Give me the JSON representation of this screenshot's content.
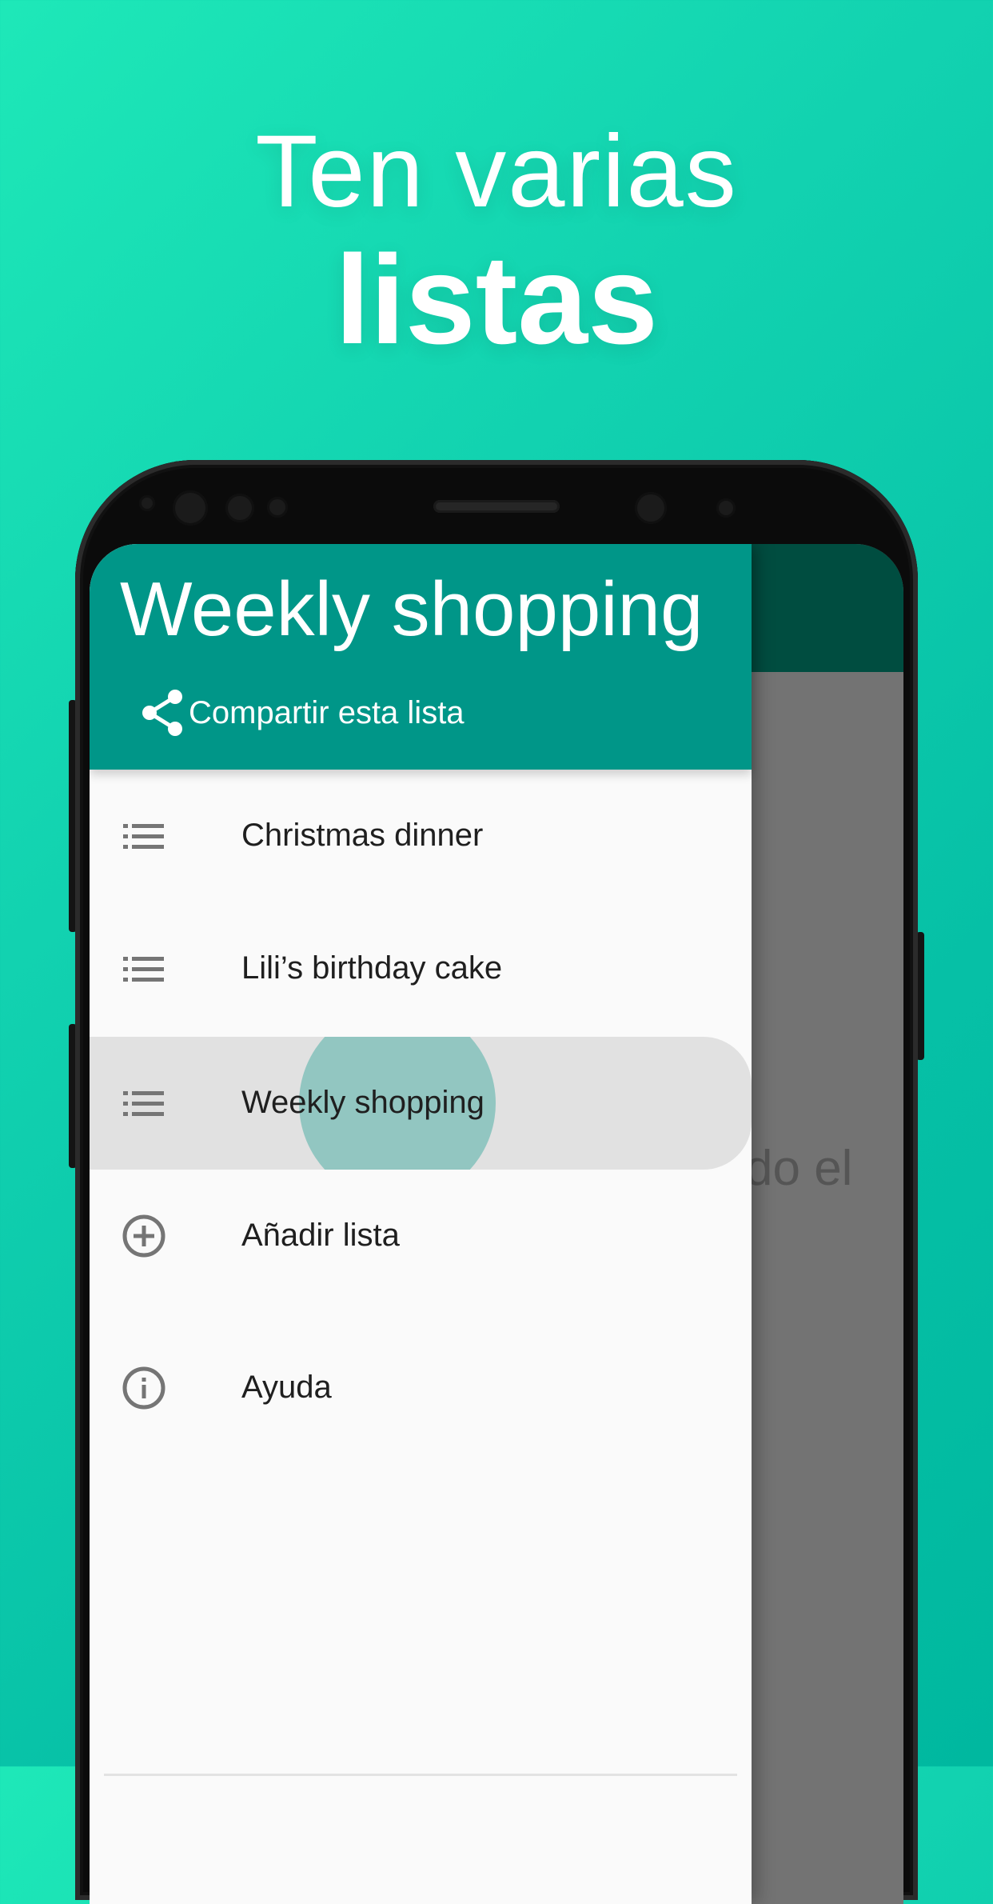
{
  "promo": {
    "line1": "Ten varias",
    "line2": "listas"
  },
  "background_screen": {
    "partial_text": "do el"
  },
  "drawer": {
    "title": "Weekly shopping",
    "share_label": "Compartir esta lista",
    "lists": [
      {
        "label": "Christmas dinner",
        "icon": "list-icon",
        "selected": false
      },
      {
        "label": "Lili’s birthday cake",
        "icon": "list-icon",
        "selected": false
      },
      {
        "label": "Weekly shopping",
        "icon": "list-icon",
        "selected": true
      }
    ],
    "add_list_label": "Añadir lista",
    "help_label": "Ayuda"
  },
  "colors": {
    "primary": "#009688",
    "primary_dark": "#004d40",
    "drawer_bg": "#fafafa",
    "selected_bg": "#e1e1e1",
    "icon_gray": "#757575"
  }
}
